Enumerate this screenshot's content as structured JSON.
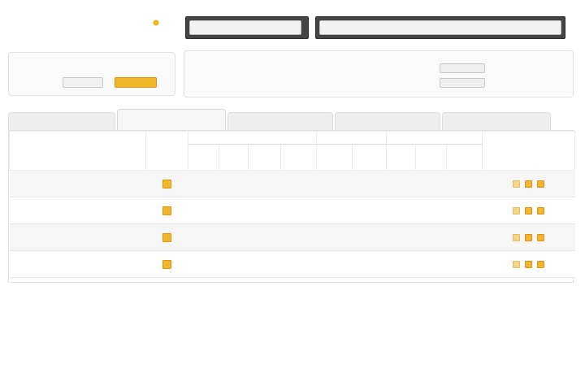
{
  "header": {
    "logo": "",
    "nav_left_label": "",
    "nav_right_label": ""
  },
  "user": {
    "name": "",
    "profile_button": "",
    "logout_button": ""
  },
  "info": {
    "lines": [
      "",
      "",
      "",
      ""
    ],
    "buttons": [
      "",
      ""
    ]
  },
  "tabs": [
    {
      "label": "",
      "active": false
    },
    {
      "label": "",
      "active": true
    },
    {
      "label": "",
      "active": false
    },
    {
      "label": "",
      "active": false
    },
    {
      "label": "",
      "active": false
    }
  ],
  "table": {
    "header_groups": [
      "",
      "",
      "",
      "",
      ""
    ],
    "header_cols": [
      "",
      "",
      "",
      "",
      "",
      "",
      "",
      "",
      "",
      ""
    ],
    "rows": [
      {
        "project": "",
        "cells": [
          "",
          "",
          "",
          "",
          "",
          "",
          "",
          "",
          ""
        ]
      },
      {
        "project": "",
        "cells": [
          "",
          "",
          "",
          "",
          "",
          "",
          "",
          "",
          ""
        ]
      },
      {
        "project": "",
        "cells": [
          "",
          "",
          "",
          "",
          "",
          "",
          "",
          "",
          ""
        ]
      },
      {
        "project": "",
        "cells": [
          "",
          "",
          "",
          "",
          "",
          "",
          "",
          "",
          ""
        ]
      }
    ]
  },
  "icons": {
    "status": "status-icon",
    "actions": [
      "info-icon",
      "edit-icon",
      "delete-icon"
    ]
  },
  "colors": {
    "accent": "#f3b52a",
    "nav_background": "#444444",
    "logo_text": "#333333",
    "logo_dot": "#f3b52a"
  }
}
